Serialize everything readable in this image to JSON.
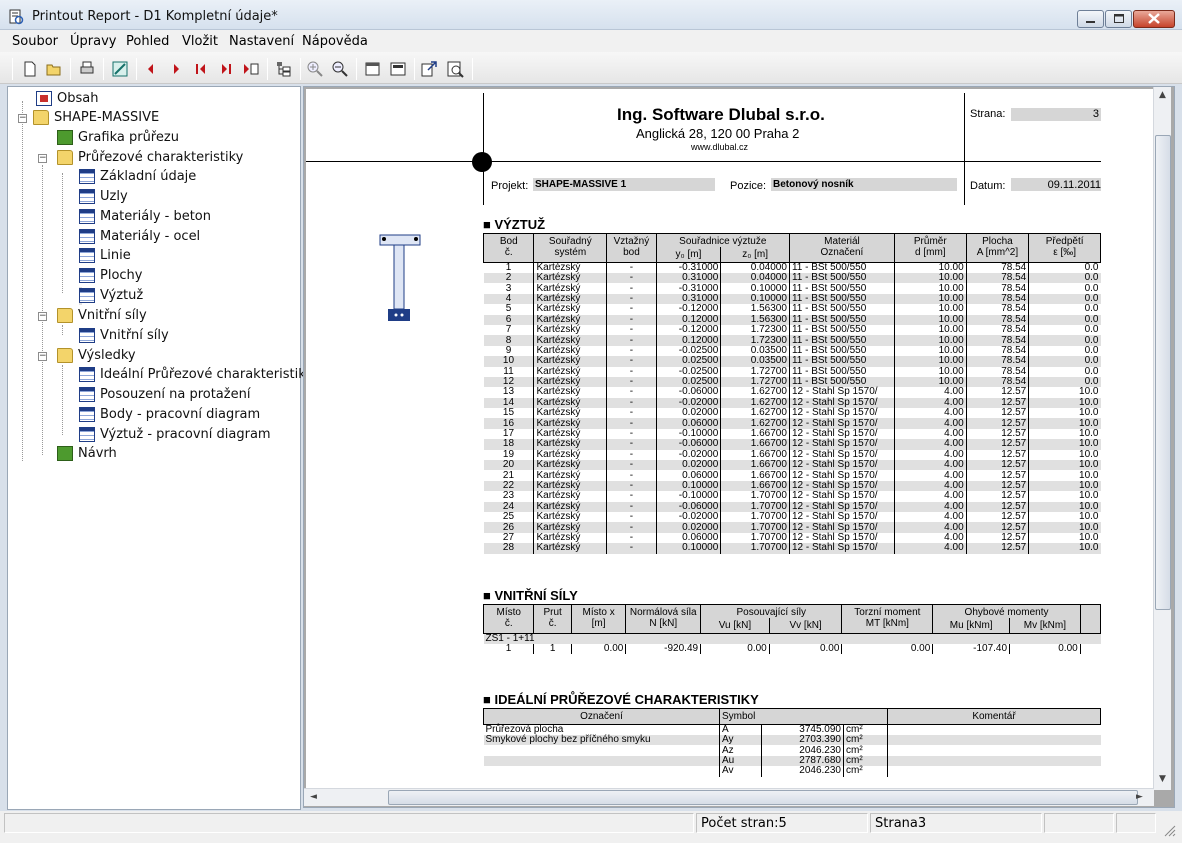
{
  "window": {
    "title": "Printout Report - D1 Kompletní údaje*"
  },
  "menu": [
    "Soubor",
    "Úpravy",
    "Pohled",
    "Vložit",
    "Nastavení",
    "Nápověda"
  ],
  "tree": [
    {
      "label": "Obsah",
      "icon": "contents-icon"
    },
    {
      "label": "SHAPE-MASSIVE",
      "icon": "folder-icon"
    },
    {
      "label": "Grafika průřezu",
      "icon": "graphics-icon"
    },
    {
      "label": "Průřezové charakteristiky",
      "icon": "folder-icon"
    },
    {
      "label": "Základní údaje",
      "icon": "table-icon"
    },
    {
      "label": "Uzly",
      "icon": "table-icon"
    },
    {
      "label": "Materiály - beton",
      "icon": "table-icon"
    },
    {
      "label": "Materiály - ocel",
      "icon": "table-icon"
    },
    {
      "label": "Linie",
      "icon": "table-icon"
    },
    {
      "label": "Plochy",
      "icon": "table-icon"
    },
    {
      "label": "Výztuž",
      "icon": "table-icon",
      "selected": true
    },
    {
      "label": "Vnitřní síly",
      "icon": "folder-icon"
    },
    {
      "label": "Vnitřní síly",
      "icon": "table-icon"
    },
    {
      "label": "Výsledky",
      "icon": "folder-icon"
    },
    {
      "label": "Ideální Průřezové charakteristiky",
      "icon": "table-icon"
    },
    {
      "label": "Posouzení na protažení",
      "icon": "table-icon"
    },
    {
      "label": "Body - pracovní diagram",
      "icon": "table-icon"
    },
    {
      "label": "Výztuž - pracovní diagram",
      "icon": "table-icon"
    },
    {
      "label": "Návrh",
      "icon": "graphics-icon"
    }
  ],
  "report": {
    "company": "Ing. Software Dlubal s.r.o.",
    "address": "Anglická 28, 120 00 Praha 2",
    "web": "www.dlubal.cz",
    "page_label": "Strana:",
    "page_value": "3",
    "project_label": "Projekt:",
    "project_value": "SHAPE-MASSIVE 1",
    "position_label": "Pozice:",
    "position_value": "Betonový nosník",
    "date_label": "Datum:",
    "date_value": "09.11.2011",
    "rebar_title": "VÝZTUŽ",
    "rebar_headers": [
      "Bod\nč.",
      "Souřadný\nsystém",
      "Vztažný\nbod",
      "Souřadnice výztuže",
      "y₀ [m]",
      "z₀ [m]",
      "Materiál\nOznačení",
      "Průměr\nd [mm]",
      "Plocha\nA [mm^2]",
      "Předpětí\nε [‰]"
    ],
    "rebar_rows": [
      [
        "1",
        "Kartézský",
        "-",
        "-0.31000",
        "0.04000",
        "11 - BSt 500/550",
        "10.00",
        "78.54",
        "0.0"
      ],
      [
        "2",
        "Kartézský",
        "-",
        "0.31000",
        "0.04000",
        "11 - BSt 500/550",
        "10.00",
        "78.54",
        "0.0"
      ],
      [
        "3",
        "Kartézský",
        "-",
        "-0.31000",
        "0.10000",
        "11 - BSt 500/550",
        "10.00",
        "78.54",
        "0.0"
      ],
      [
        "4",
        "Kartézský",
        "-",
        "0.31000",
        "0.10000",
        "11 - BSt 500/550",
        "10.00",
        "78.54",
        "0.0"
      ],
      [
        "5",
        "Kartézský",
        "-",
        "-0.12000",
        "1.56300",
        "11 - BSt 500/550",
        "10.00",
        "78.54",
        "0.0"
      ],
      [
        "6",
        "Kartézský",
        "-",
        "0.12000",
        "1.56300",
        "11 - BSt 500/550",
        "10.00",
        "78.54",
        "0.0"
      ],
      [
        "7",
        "Kartézský",
        "-",
        "-0.12000",
        "1.72300",
        "11 - BSt 500/550",
        "10.00",
        "78.54",
        "0.0"
      ],
      [
        "8",
        "Kartézský",
        "-",
        "0.12000",
        "1.72300",
        "11 - BSt 500/550",
        "10.00",
        "78.54",
        "0.0"
      ],
      [
        "9",
        "Kartézský",
        "-",
        "-0.02500",
        "0.03500",
        "11 - BSt 500/550",
        "10.00",
        "78.54",
        "0.0"
      ],
      [
        "10",
        "Kartézský",
        "-",
        "0.02500",
        "0.03500",
        "11 - BSt 500/550",
        "10.00",
        "78.54",
        "0.0"
      ],
      [
        "11",
        "Kartézský",
        "-",
        "-0.02500",
        "1.72700",
        "11 - BSt 500/550",
        "10.00",
        "78.54",
        "0.0"
      ],
      [
        "12",
        "Kartézský",
        "-",
        "0.02500",
        "1.72700",
        "11 - BSt 500/550",
        "10.00",
        "78.54",
        "0.0"
      ],
      [
        "13",
        "Kartézský",
        "-",
        "-0.06000",
        "1.62700",
        "12 - Stahl Sp 1570/",
        "4.00",
        "12.57",
        "10.0"
      ],
      [
        "14",
        "Kartézský",
        "-",
        "-0.02000",
        "1.62700",
        "12 - Stahl Sp 1570/",
        "4.00",
        "12.57",
        "10.0"
      ],
      [
        "15",
        "Kartézský",
        "-",
        "0.02000",
        "1.62700",
        "12 - Stahl Sp 1570/",
        "4.00",
        "12.57",
        "10.0"
      ],
      [
        "16",
        "Kartézský",
        "-",
        "0.06000",
        "1.62700",
        "12 - Stahl Sp 1570/",
        "4.00",
        "12.57",
        "10.0"
      ],
      [
        "17",
        "Kartézský",
        "-",
        "-0.10000",
        "1.66700",
        "12 - Stahl Sp 1570/",
        "4.00",
        "12.57",
        "10.0"
      ],
      [
        "18",
        "Kartézský",
        "-",
        "-0.06000",
        "1.66700",
        "12 - Stahl Sp 1570/",
        "4.00",
        "12.57",
        "10.0"
      ],
      [
        "19",
        "Kartézský",
        "-",
        "-0.02000",
        "1.66700",
        "12 - Stahl Sp 1570/",
        "4.00",
        "12.57",
        "10.0"
      ],
      [
        "20",
        "Kartézský",
        "-",
        "0.02000",
        "1.66700",
        "12 - Stahl Sp 1570/",
        "4.00",
        "12.57",
        "10.0"
      ],
      [
        "21",
        "Kartézský",
        "-",
        "0.06000",
        "1.66700",
        "12 - Stahl Sp 1570/",
        "4.00",
        "12.57",
        "10.0"
      ],
      [
        "22",
        "Kartézský",
        "-",
        "0.10000",
        "1.66700",
        "12 - Stahl Sp 1570/",
        "4.00",
        "12.57",
        "10.0"
      ],
      [
        "23",
        "Kartézský",
        "-",
        "-0.10000",
        "1.70700",
        "12 - Stahl Sp 1570/",
        "4.00",
        "12.57",
        "10.0"
      ],
      [
        "24",
        "Kartézský",
        "-",
        "-0.06000",
        "1.70700",
        "12 - Stahl Sp 1570/",
        "4.00",
        "12.57",
        "10.0"
      ],
      [
        "25",
        "Kartézský",
        "-",
        "-0.02000",
        "1.70700",
        "12 - Stahl Sp 1570/",
        "4.00",
        "12.57",
        "10.0"
      ],
      [
        "26",
        "Kartézský",
        "-",
        "0.02000",
        "1.70700",
        "12 - Stahl Sp 1570/",
        "4.00",
        "12.57",
        "10.0"
      ],
      [
        "27",
        "Kartézský",
        "-",
        "0.06000",
        "1.70700",
        "12 - Stahl Sp 1570/",
        "4.00",
        "12.57",
        "10.0"
      ],
      [
        "28",
        "Kartézský",
        "-",
        "0.10000",
        "1.70700",
        "12 - Stahl Sp 1570/",
        "4.00",
        "12.57",
        "10.0"
      ]
    ],
    "forces_title": "VNITŘNÍ SÍLY",
    "forces_headers": [
      "Místo\nč.",
      "Prut\nč.",
      "Místo x\n[m]",
      "Normálová síla\nN [kN]",
      "Posouvající síly",
      "Vu [kN]",
      "Vv [kN]",
      "Torzní moment\nMT [kNm]",
      "Ohybové momenty",
      "Mu [kNm]",
      "Mv [kNm]"
    ],
    "forces_group": "ZS1 - 1+11",
    "forces_row": [
      "1",
      "1",
      "0.00",
      "-920.49",
      "0.00",
      "0.00",
      "0.00",
      "-107.40",
      "0.00"
    ],
    "ideal_title": "IDEÁLNÍ PRŮŘEZOVÉ CHARAKTERISTIKY",
    "ideal_headers": [
      "Označení",
      "Symbol",
      "Komentář"
    ],
    "ideal_desc": [
      "Průřezová plocha",
      "Smykové plochy bez příčného smyku"
    ],
    "ideal_rows": [
      {
        "sym": "A",
        "val": "3745.090",
        "unit": "cm²"
      },
      {
        "sym": "Ay",
        "val": "2703.390",
        "unit": "cm²"
      },
      {
        "sym": "Az",
        "val": "2046.230",
        "unit": "cm²"
      },
      {
        "sym": "Au",
        "val": "2787.680",
        "unit": "cm²"
      },
      {
        "sym": "Av",
        "val": "2046.230",
        "unit": "cm²"
      }
    ]
  },
  "status": {
    "pages": "Počet stran:5",
    "current": "Strana3"
  }
}
